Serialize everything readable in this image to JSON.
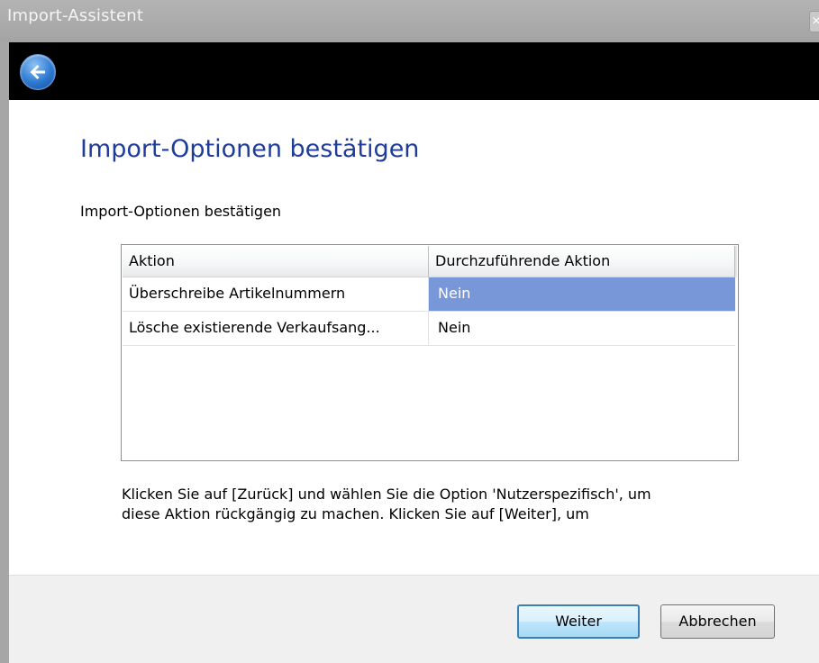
{
  "window": {
    "title": "Import-Assistent",
    "close_glyph": "×"
  },
  "nav": {
    "back_icon": "back-arrow-icon"
  },
  "page": {
    "heading": "Import-Optionen bestätigen",
    "subheading": "Import-Optionen bestätigen"
  },
  "table": {
    "columns": [
      "Aktion",
      "Durchzuführende Aktion"
    ],
    "rows": [
      {
        "action": "Überschreibe Artikelnummern",
        "value": "Nein",
        "selected": true
      },
      {
        "action": "Lösche existierende Verkaufsang...",
        "value": "Nein",
        "selected": false
      }
    ],
    "selection_color": "#7897d9"
  },
  "info": {
    "line1": "Klicken Sie auf [Zurück] und wählen Sie die Option 'Nutzerspezifisch', um",
    "line2": "diese Aktion rückgängig zu machen. Klicken Sie auf [Weiter], um"
  },
  "footer": {
    "next_label": "Weiter",
    "cancel_label": "Abbrechen"
  },
  "colors": {
    "heading": "#1f3c9a",
    "navbar": "#000000",
    "titlebar": "#a9a9a9"
  }
}
